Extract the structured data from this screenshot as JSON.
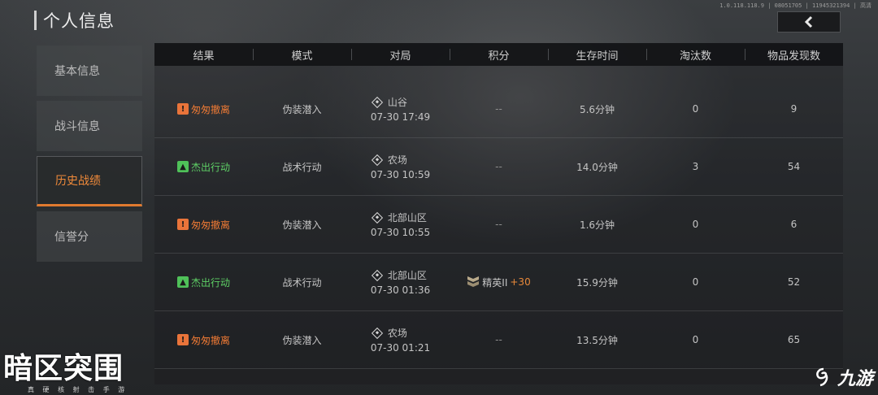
{
  "header": {
    "title": "个人信息",
    "meta": "1.0.118.118.9 | 08051705 | 11945321394 | 高清"
  },
  "sidebar": {
    "items": [
      {
        "label": "基本信息",
        "active": false
      },
      {
        "label": "战斗信息",
        "active": false
      },
      {
        "label": "历史战绩",
        "active": true
      },
      {
        "label": "信誉分",
        "active": false
      }
    ]
  },
  "table": {
    "columns": [
      "结果",
      "模式",
      "对局",
      "积分",
      "生存时间",
      "淘汰数",
      "物品发现数"
    ],
    "rows": [
      {
        "result": "匆匆撤离",
        "result_type": "fail",
        "mode": "伪装潜入",
        "map": "山谷",
        "time": "07-30 17:49",
        "score": "--",
        "survival": "5.6分钟",
        "kills": "0",
        "items": "9"
      },
      {
        "result": "杰出行动",
        "result_type": "win",
        "mode": "战术行动",
        "map": "农场",
        "time": "07-30 10:59",
        "score": "--",
        "survival": "14.0分钟",
        "kills": "3",
        "items": "54"
      },
      {
        "result": "匆匆撤离",
        "result_type": "fail",
        "mode": "伪装潜入",
        "map": "北部山区",
        "time": "07-30 10:55",
        "score": "--",
        "survival": "1.6分钟",
        "kills": "0",
        "items": "6"
      },
      {
        "result": "杰出行动",
        "result_type": "win",
        "mode": "战术行动",
        "map": "北部山区",
        "time": "07-30 01:36",
        "score_rank": "精英II",
        "score_plus": "+30",
        "survival": "15.9分钟",
        "kills": "0",
        "items": "52"
      },
      {
        "result": "匆匆撤离",
        "result_type": "fail",
        "mode": "伪装潜入",
        "map": "农场",
        "time": "07-30 01:21",
        "score": "--",
        "survival": "13.5分钟",
        "kills": "0",
        "items": "65"
      }
    ]
  },
  "branding": {
    "game_logo": "暗区突围",
    "game_subtitle": "真 硬 核 射 击 手 游",
    "site_logo": "九游"
  },
  "colors": {
    "accent": "#e07a2f",
    "fail": "#ef7a35",
    "win": "#5ed065"
  },
  "icons": {
    "back": "chevron-left-icon",
    "fail": "warning-icon",
    "win": "flame-icon",
    "map": "map-pin-icon",
    "rank": "rank-chevron-icon"
  }
}
